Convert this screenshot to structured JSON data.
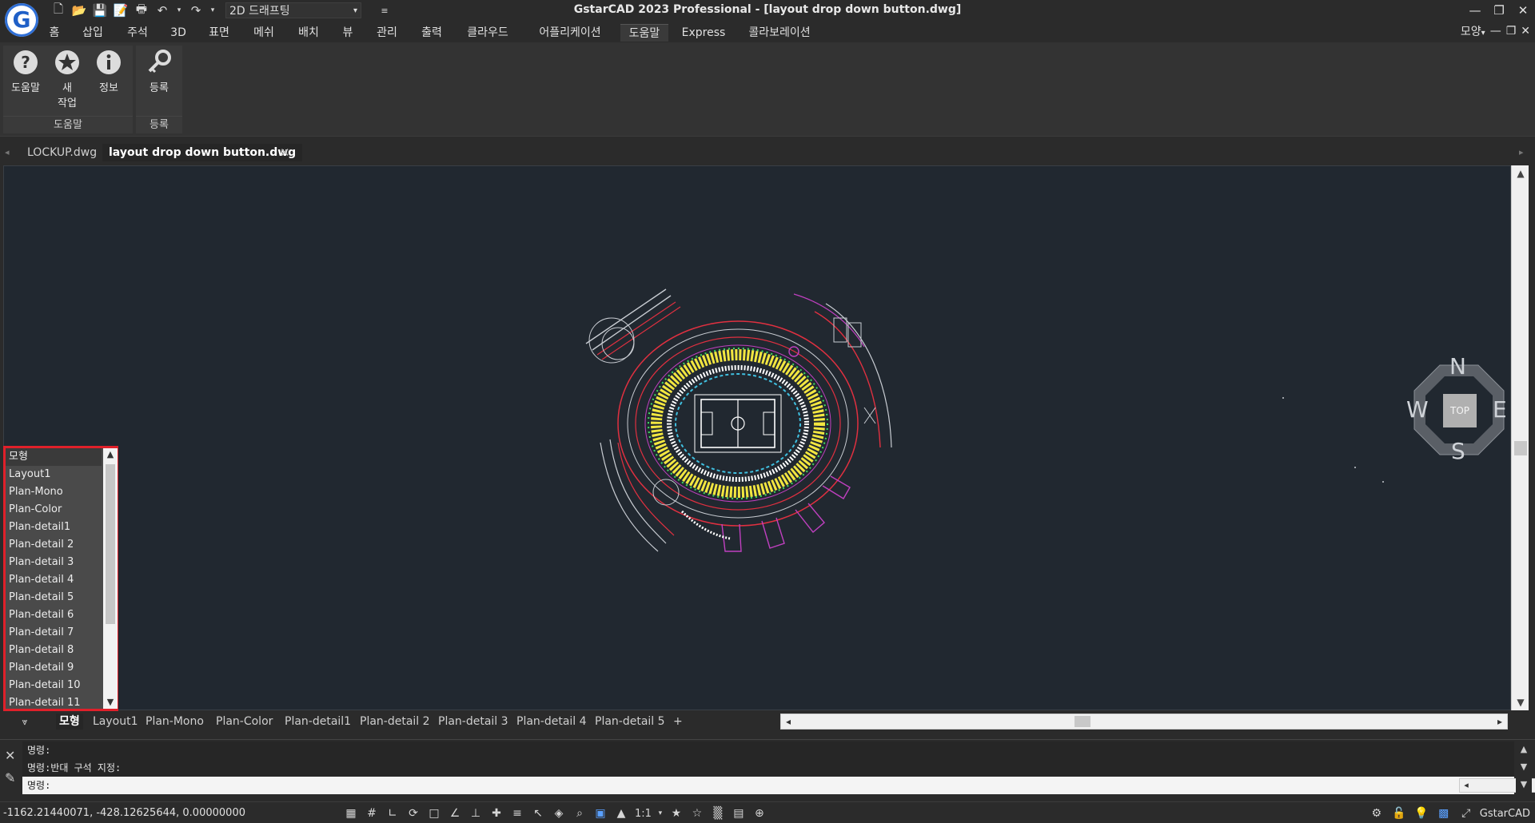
{
  "titlebar": {
    "logo_letter": "G",
    "workspace": "2D 드래프팅",
    "title": "GstarCAD 2023 Professional - [layout drop down button.dwg]"
  },
  "ribbon_tabs": [
    "홈",
    "삽입",
    "주석",
    "3D",
    "표면",
    "메쉬",
    "배치",
    "뷰",
    "관리",
    "출력",
    "클라우드",
    "어플리케이션",
    "도움말",
    "Express",
    "콜라보레이션"
  ],
  "ribbon_active_tab": "도움말",
  "ribbon_right": {
    "style_label": "모양"
  },
  "ribbon_groups": {
    "help": {
      "label": "도움말",
      "buttons": {
        "help": "도움말",
        "new_line1": "새",
        "new_line2": "작업",
        "info": "정보"
      }
    },
    "register": {
      "label": "등록",
      "buttons": {
        "register": "등록"
      }
    }
  },
  "documents": {
    "tab1": "LOCKUP.dwg",
    "tab2": "layout drop down button.dwg"
  },
  "viewcube": {
    "n": "N",
    "s": "S",
    "e": "E",
    "w": "W",
    "top": "TOP"
  },
  "layout_list": {
    "items": [
      "모형",
      "Layout1",
      "Plan-Mono",
      "Plan-Color",
      "Plan-detail1",
      "Plan-detail 2",
      "Plan-detail 3",
      "Plan-detail 4",
      "Plan-detail 5",
      "Plan-detail 6",
      "Plan-detail 7",
      "Plan-detail 8",
      "Plan-detail 9",
      "Plan-detail 10",
      "Plan-detail 11"
    ]
  },
  "layout_tabs": {
    "model": "모형",
    "tabs": [
      "Layout1",
      "Plan-Mono",
      "Plan-Color",
      "Plan-detail1",
      "Plan-detail 2",
      "Plan-detail 3",
      "Plan-detail 4",
      "Plan-detail 5"
    ],
    "add": "+"
  },
  "command": {
    "history": [
      "명령:",
      "명령:반대 구석 지정:"
    ],
    "prompt": "명령:",
    "input_value": ""
  },
  "status": {
    "coords": "-1162.21440071, -428.12625644, 0.00000000",
    "scale": "1:1",
    "brand": "GstarCAD"
  },
  "colors": {
    "canvas_bg": "#212830",
    "highlight_border": "#e0202a",
    "accent": "#2f6fd6"
  }
}
